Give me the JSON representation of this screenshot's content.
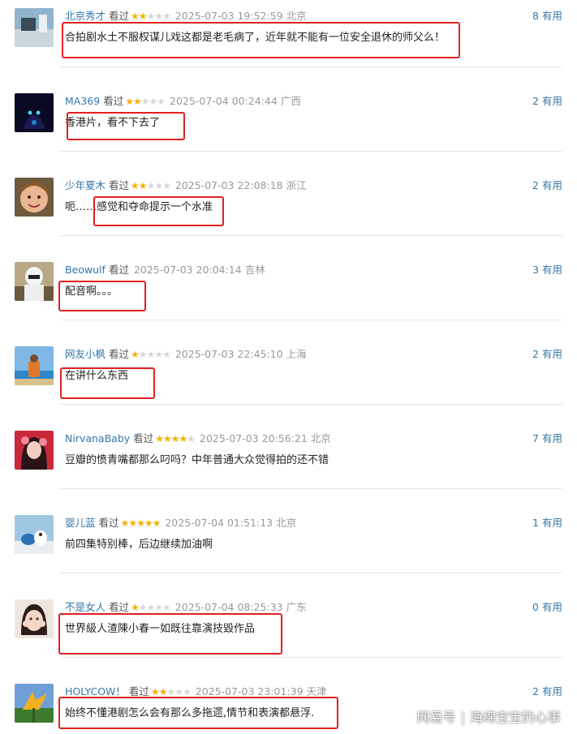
{
  "comments": [
    {
      "user": "北京秀才",
      "watched": "看过",
      "rating": 2,
      "time": "2025-07-03 19:52:59",
      "location": "北京",
      "useful_count": "8",
      "useful_label": "有用",
      "text": "合拍剧水土不服权谋儿戏这都是老毛病了，近年就不能有一位安全退休的师父么！"
    },
    {
      "user": "MA369",
      "watched": "看过",
      "rating": 2,
      "time": "2025-07-04 00:24:44",
      "location": "广西",
      "useful_count": "2",
      "useful_label": "有用",
      "text": "香港片，看不下去了"
    },
    {
      "user": "少年夏木",
      "watched": "看过",
      "rating": 2,
      "time": "2025-07-03 22:08:18",
      "location": "浙江",
      "useful_count": "2",
      "useful_label": "有用",
      "text": "呃……感觉和夺命提示一个水准"
    },
    {
      "user": "Beowulf",
      "watched": "看过",
      "rating": 0,
      "time": "2025-07-03 20:04:14",
      "location": "吉林",
      "useful_count": "3",
      "useful_label": "有用",
      "text": "配音啊。。。"
    },
    {
      "user": "网友小枫",
      "watched": "看过",
      "rating": 1,
      "time": "2025-07-03 22:45:10",
      "location": "上海",
      "useful_count": "2",
      "useful_label": "有用",
      "text": "在讲什么东西"
    },
    {
      "user": "NirvanaBaby",
      "watched": "看过",
      "rating": 4,
      "time": "2025-07-03 20:56:21",
      "location": "北京",
      "useful_count": "7",
      "useful_label": "有用",
      "text": "豆瓣的愤青嘴都那么叼吗？中年普通大众觉得拍的还不错"
    },
    {
      "user": "婴儿蓝",
      "watched": "看过",
      "rating": 5,
      "time": "2025-07-04 01:51:13",
      "location": "北京",
      "useful_count": "1",
      "useful_label": "有用",
      "text": "前四集特别棒，后边继续加油啊"
    },
    {
      "user": "不是女人",
      "watched": "看过",
      "rating": 1,
      "time": "2025-07-04 08:25:33",
      "location": "广东",
      "useful_count": "0",
      "useful_label": "有用",
      "text": "世界級人渣陳小春一如既往靠演技毀作品"
    },
    {
      "user": "HOLYCOW！",
      "watched": "看过",
      "rating": 2,
      "time": "2025-07-03 23:01:39",
      "location": "天津",
      "useful_count": "2",
      "useful_label": "有用",
      "text": "始终不懂港剧怎么会有那么多拖遝,情节和表演都悬浮."
    }
  ],
  "watermark": {
    "brand": "网易号",
    "separator": "|",
    "author": "海绵宝宝的心事"
  },
  "colors": {
    "username": "#3377aa",
    "star_on": "#f5b100",
    "star_off": "#d7d7d7",
    "highlight_box": "#e02020",
    "meta_gray": "#999999"
  }
}
